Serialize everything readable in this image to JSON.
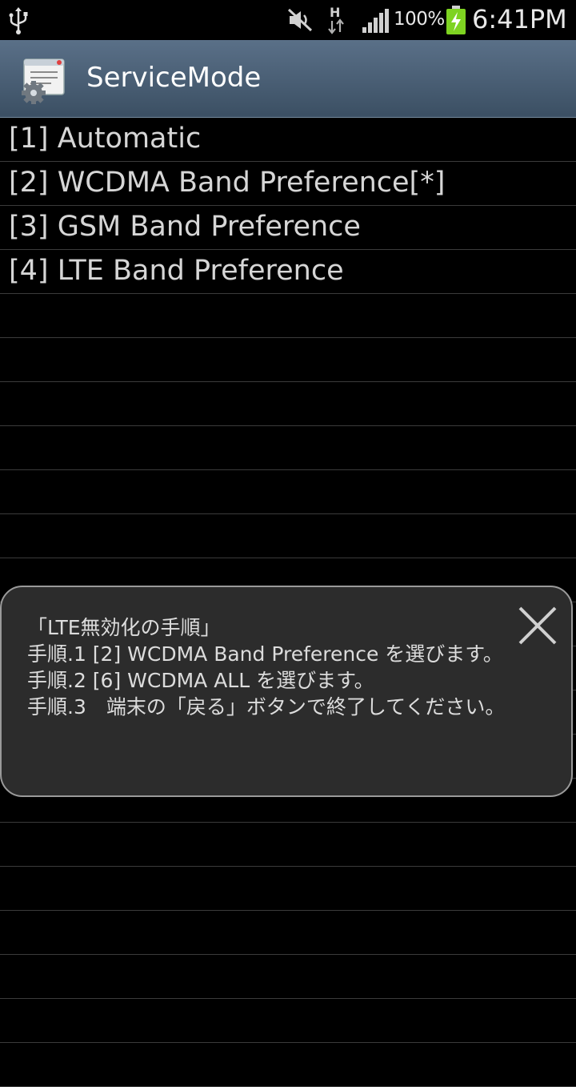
{
  "status_bar": {
    "battery_percent": "100%",
    "time": "6:41PM",
    "network_label": "H",
    "icons": [
      "usb-icon",
      "mute-icon",
      "hspa-data-icon",
      "signal-icon",
      "battery-charging-icon"
    ]
  },
  "action_bar": {
    "title": "ServiceMode",
    "icon": "service-mode-app-icon"
  },
  "list": {
    "items": [
      {
        "label": "[1] Automatic"
      },
      {
        "label": "[2] WCDMA Band Preference[*]"
      },
      {
        "label": "[3] GSM Band Preference"
      },
      {
        "label": "[4] LTE Band Preference"
      },
      {
        "label": ""
      },
      {
        "label": ""
      },
      {
        "label": ""
      },
      {
        "label": ""
      },
      {
        "label": ""
      },
      {
        "label": ""
      },
      {
        "label": ""
      },
      {
        "label": ""
      },
      {
        "label": ""
      },
      {
        "label": ""
      },
      {
        "label": ""
      },
      {
        "label": ""
      },
      {
        "label": ""
      },
      {
        "label": ""
      },
      {
        "label": ""
      },
      {
        "label": ""
      },
      {
        "label": ""
      },
      {
        "label": ""
      }
    ]
  },
  "popup": {
    "lines": [
      "「LTE無効化の手順」",
      "手順.1 [2] WCDMA Band Preference を選びます。",
      "手順.2 [6] WCDMA ALL を選びます。",
      "手順.3　端末の「戻る」ボタンで終了してください。"
    ],
    "close_icon": "close-icon"
  },
  "colors": {
    "background": "#000000",
    "action_bar_top": "#5a7088",
    "action_bar_bottom": "#3b4f63",
    "popup_background": "#2c2c2c",
    "popup_border": "#9a9a9a",
    "battery_charging": "#7ed321"
  }
}
